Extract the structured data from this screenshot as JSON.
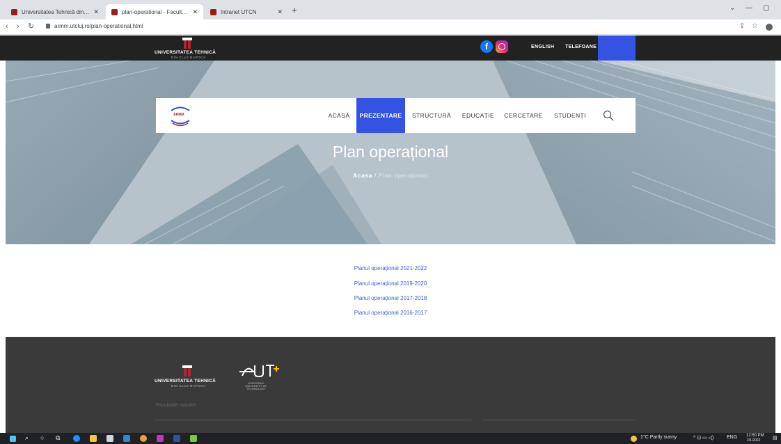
{
  "browser": {
    "tabs": [
      {
        "title": "Universitatea Tehnică din Cluj-N",
        "active": false
      },
      {
        "title": "plan-operational - Facultatea de",
        "active": true
      },
      {
        "title": "Intranet UTCN",
        "active": false
      }
    ],
    "close_glyph": "✕",
    "new_tab_glyph": "+",
    "url": "armm.utcluj.ro/plan-operational.html",
    "window_controls": [
      "⌄",
      "—",
      "▢"
    ]
  },
  "header": {
    "logo_text": "UNIVERSITATEA TEHNICĂ",
    "logo_subtext": "DIN CLUJ-NAPOCA",
    "facebook_glyph": "f",
    "links": [
      "ENGLISH",
      "TELEFOANE"
    ]
  },
  "nav": {
    "items": [
      {
        "label": "ACASĂ",
        "active": false
      },
      {
        "label": "PREZENTARE",
        "active": true
      },
      {
        "label": "STRUCTURĂ",
        "active": false
      },
      {
        "label": "EDUCAȚIE",
        "active": false
      },
      {
        "label": "CERCETARE",
        "active": false
      },
      {
        "label": "STUDENȚI",
        "active": false
      }
    ],
    "search_icon": "search-icon",
    "logo_label": "ARMM"
  },
  "hero": {
    "title": "Plan operațional",
    "breadcrumb_home": "Acasa",
    "breadcrumb_sep": " / ",
    "breadcrumb_current": "Plan operațional"
  },
  "content": {
    "links": [
      "Planul operațional 2021-2022",
      "Planul operațional 2019-2020",
      "Planul operațional 2017-2018",
      "Planul operațional 2016-2017"
    ]
  },
  "footer": {
    "logo_text": "UNIVERSITATEA TEHNICĂ",
    "logo_subtext": "DIN CLUJ-NAPOCA",
    "eut_text": "EUT+",
    "eut_subtext": "EUROPEAN UNIVERSITY OF TECHNOLOGY",
    "faculties_label": "Facultatile noastre"
  },
  "taskbar": {
    "weather": "1°C Partly sunny",
    "lang": "ENG",
    "time": "12:50 PM",
    "date": "2/1/2022"
  },
  "colors": {
    "accent": "#3553e3",
    "header_bg": "#222222",
    "footer_bg": "#3a3a3a",
    "link": "#3f5ad9",
    "brand_red": "#b3262b"
  }
}
